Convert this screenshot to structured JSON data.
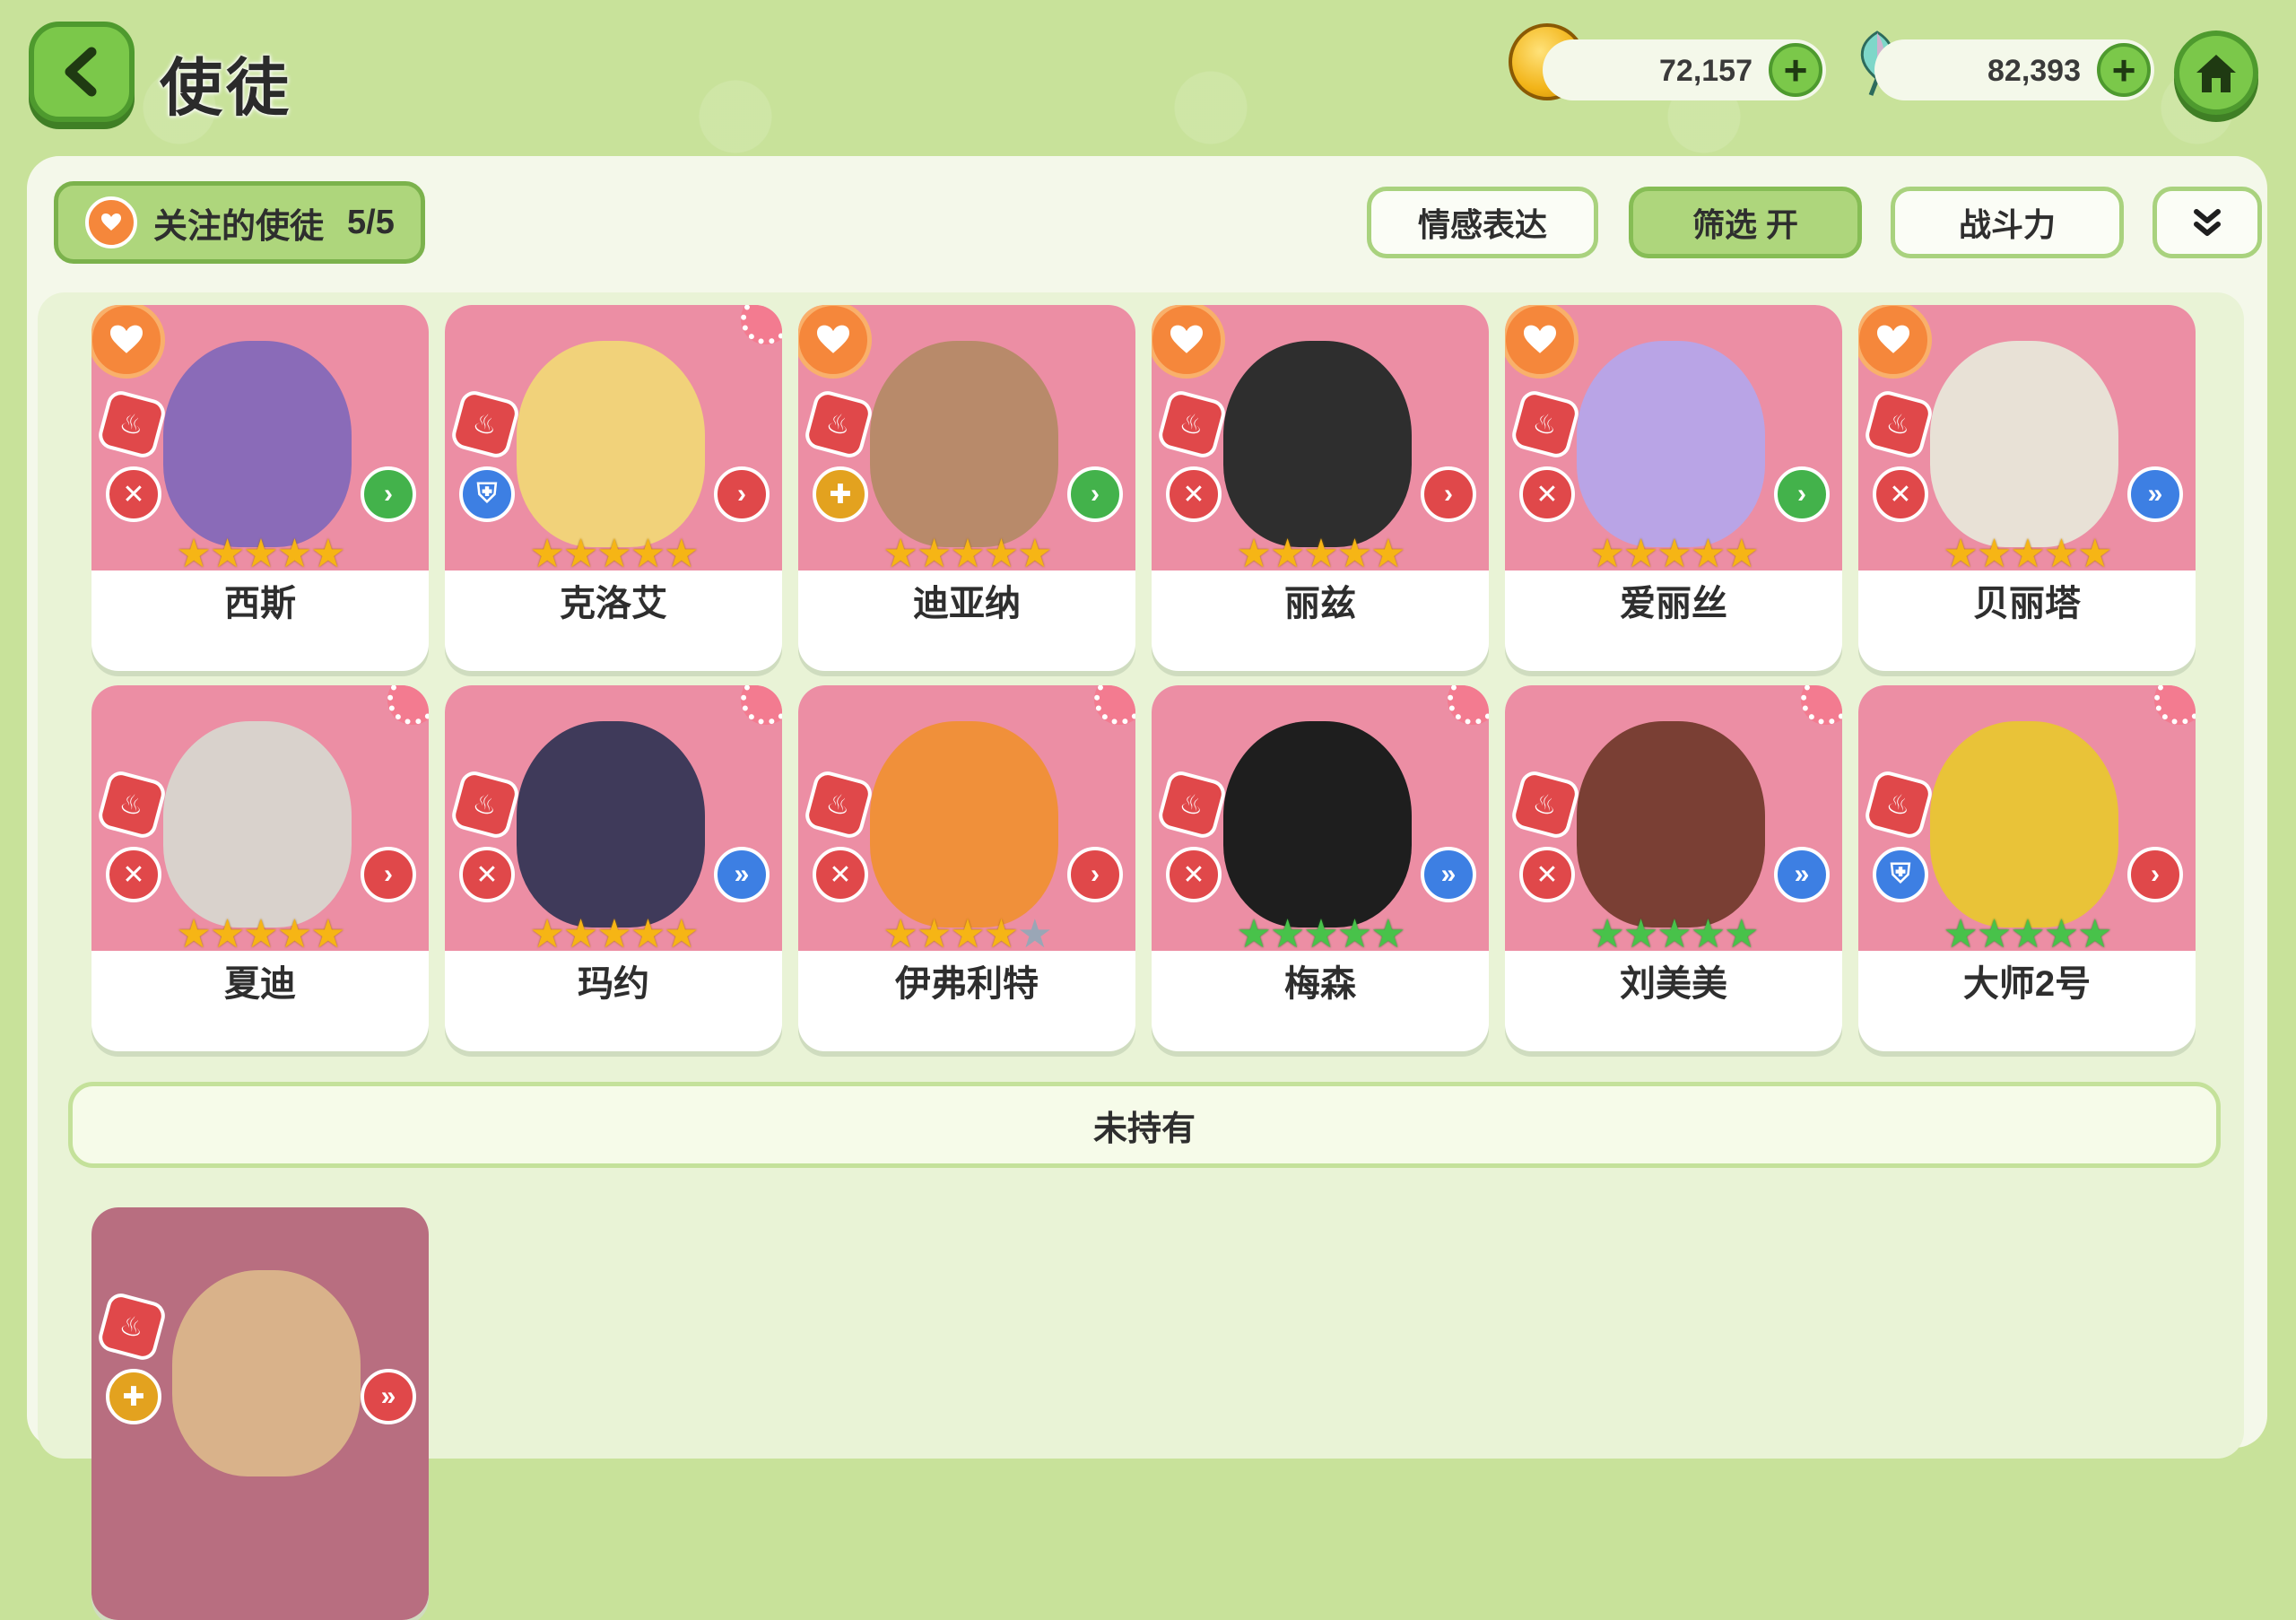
{
  "header": {
    "title": "使徒",
    "gold": "72,157",
    "gems": "82,393",
    "plus_label": "+"
  },
  "toolbar": {
    "favorites_label": "关注的使徒",
    "favorites_count": "5/5",
    "emotion_label": "情感表达",
    "filter_label": "筛选 开",
    "power_label": "战斗力"
  },
  "owned": [
    {
      "name": "西斯",
      "stars": 5,
      "star_color": "gold",
      "favorite": true,
      "role": "red",
      "position": "green"
    },
    {
      "name": "克洛艾",
      "stars": 5,
      "star_color": "gold",
      "favorite": false,
      "role": "blue",
      "position": "red"
    },
    {
      "name": "迪亚纳",
      "stars": 5,
      "star_color": "gold",
      "favorite": true,
      "role": "gold",
      "position": "green"
    },
    {
      "name": "丽兹",
      "stars": 5,
      "star_color": "gold",
      "favorite": true,
      "role": "red",
      "position": "red"
    },
    {
      "name": "爱丽丝",
      "stars": 5,
      "star_color": "gold",
      "favorite": true,
      "role": "red",
      "position": "green"
    },
    {
      "name": "贝丽塔",
      "stars": 5,
      "star_color": "gold",
      "favorite": true,
      "role": "red",
      "position": "blue"
    },
    {
      "name": "夏迪",
      "stars": 5,
      "star_color": "gold",
      "favorite": false,
      "role": "red",
      "position": "red"
    },
    {
      "name": "玛约",
      "stars": 5,
      "star_color": "gold",
      "favorite": false,
      "role": "red",
      "position": "blue"
    },
    {
      "name": "伊弗利特",
      "stars": 4,
      "star_color": "gold",
      "favorite": false,
      "role": "red",
      "position": "red"
    },
    {
      "name": "梅森",
      "stars": 5,
      "star_color": "green",
      "favorite": false,
      "role": "red",
      "position": "blue"
    },
    {
      "name": "刘美美",
      "stars": 5,
      "star_color": "green",
      "favorite": false,
      "role": "red",
      "position": "blue"
    },
    {
      "name": "大师2号",
      "stars": 5,
      "star_color": "green",
      "favorite": false,
      "role": "blue",
      "position": "red"
    }
  ],
  "unowned_label": "未持有",
  "colors": {
    "accent": "#7bc84a",
    "card_bg": "#ec8ea4",
    "favorite": "#f5873b"
  }
}
